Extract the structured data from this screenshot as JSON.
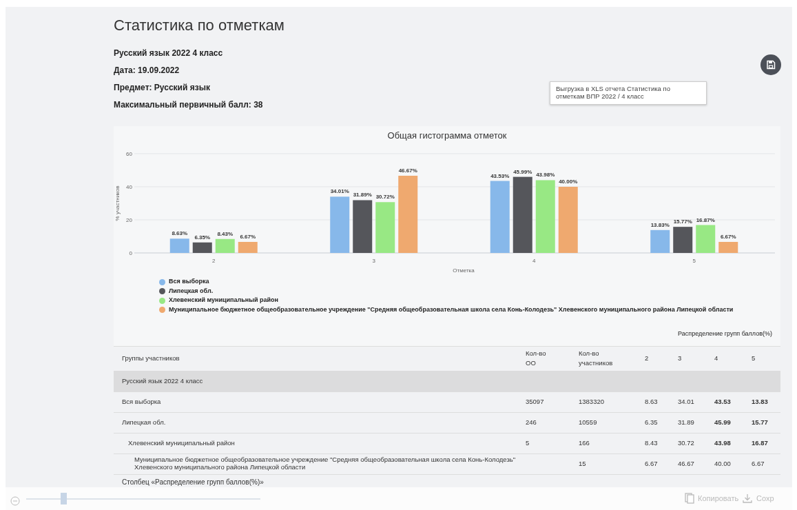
{
  "title": "Статистика по отметкам",
  "info": [
    "Русский язык 2022 4 класс",
    "Дата: 19.09.2022",
    "Предмет: Русский язык",
    "Максимальный первичный балл: 38"
  ],
  "export_tooltip": "Выгрузка в XLS отчета Статистика по отметкам ВПР 2022 / 4 класс",
  "chart": {
    "chart_data": {
      "type": "bar",
      "title": "Общая гистограмма отметок",
      "xlabel": "Отметка",
      "ylabel": "% участников",
      "categories": [
        "2",
        "3",
        "4",
        "5"
      ],
      "ylim": [
        0,
        60
      ],
      "yticks": [
        0,
        20,
        40,
        60
      ],
      "value_labels": [
        [
          "8.63%",
          "34.01%",
          "43.53%",
          "13.83%"
        ],
        [
          "6.35%",
          "31.89%",
          "45.99%",
          "15.77%"
        ],
        [
          "8.43%",
          "30.72%",
          "43.98%",
          "16.87%"
        ],
        [
          "6.67%",
          "46.67%",
          "40.00%",
          "6.67%"
        ]
      ],
      "series": [
        {
          "name": "Вся выборка",
          "color": "#87b8ea",
          "values": [
            8.63,
            34.01,
            43.53,
            13.83
          ]
        },
        {
          "name": "Липецкая обл.",
          "color": "#55565b",
          "values": [
            6.35,
            31.89,
            45.99,
            15.77
          ]
        },
        {
          "name": "Хлевенский муниципальный район",
          "color": "#98e884",
          "values": [
            8.43,
            30.72,
            43.98,
            16.87
          ]
        },
        {
          "name": "Муниципальное бюджетное общеобразовательное учреждение \"Средняя общеобразовательная школа села Конь-Колодезь\" Хлевенского муниципального района Липецкой области",
          "color": "#efa96f",
          "values": [
            6.67,
            46.67,
            40.0,
            6.67
          ]
        }
      ]
    }
  },
  "table": {
    "group_caption": "Распределение групп баллов(%)",
    "columns": [
      "Группы участников",
      "Кол-во ОО",
      "Кол-во участников",
      "2",
      "3",
      "4",
      "5"
    ],
    "section": "Русский язык 2022 4 класс",
    "rows": [
      {
        "cells": [
          {
            "text": "Вся выборка"
          },
          {
            "text": "35097"
          },
          {
            "text": "1383320"
          },
          {
            "text": "8.63",
            "bold": false
          },
          {
            "text": "34.01",
            "bold": false
          },
          {
            "text": "43.53",
            "bold": true
          },
          {
            "text": "13.83",
            "bold": true
          }
        ]
      },
      {
        "cells": [
          {
            "text": "Липецкая обл."
          },
          {
            "text": "246"
          },
          {
            "text": "10559"
          },
          {
            "text": "6.35",
            "bold": false
          },
          {
            "text": "31.89",
            "bold": false
          },
          {
            "text": "45.99",
            "bold": true
          },
          {
            "text": "15.77",
            "bold": true
          }
        ],
        "children": [
          {
            "cells": [
              {
                "text": "Хлевенский муниципальный район"
              },
              {
                "text": "5"
              },
              {
                "text": "166"
              },
              {
                "text": "8.43",
                "bold": false
              },
              {
                "text": "30.72",
                "bold": false
              },
              {
                "text": "43.98",
                "bold": true
              },
              {
                "text": "16.87",
                "bold": true
              }
            ],
            "children": [
              {
                "cells": [
                  {
                    "text": "Муниципальное бюджетное общеобразовательное учреждение \"Средняя общеобразовательная школа села Конь-Колодезь\" Хлевенского муниципального района Липецкой области"
                  },
                  {
                    "text": ""
                  },
                  {
                    "text": "15"
                  },
                  {
                    "text": "6.67",
                    "bold": false
                  },
                  {
                    "text": "46.67",
                    "bold": false
                  },
                  {
                    "text": "40.00",
                    "bold": false
                  },
                  {
                    "text": "6.67",
                    "bold": false
                  }
                ]
              }
            ]
          }
        ]
      }
    ],
    "footnote": "Столбец «Распределение групп баллов(%)»"
  },
  "viewer_toolbar": {
    "zoom": {
      "level": 0.15
    },
    "copy": "Копировать",
    "save": "Сохр"
  }
}
